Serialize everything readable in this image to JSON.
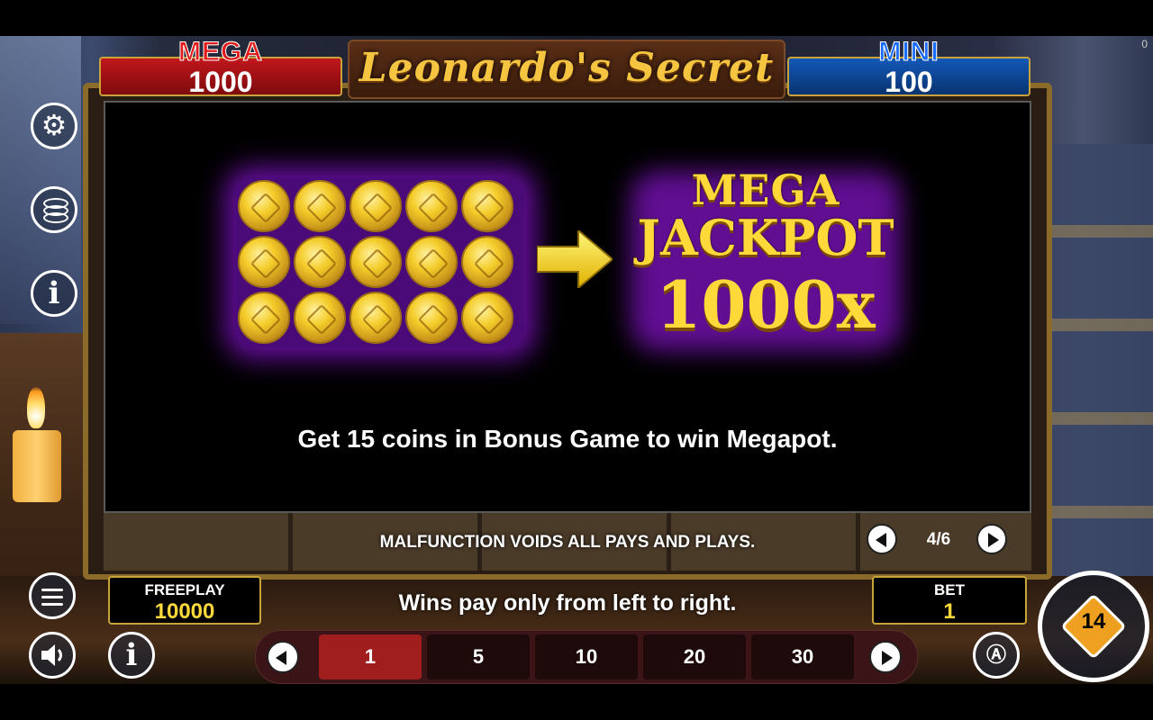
{
  "game": {
    "title": "Leonardo's Secret"
  },
  "jackpots": {
    "mega": {
      "label": "MEGA",
      "value": "1000"
    },
    "mini": {
      "label": "MINI",
      "value": "100"
    }
  },
  "corner_indicator": "0",
  "info_page": {
    "mega_title_line1": "MEGA",
    "mega_title_line2": "JACKPOT",
    "multiplier": "1000x",
    "coin_count": 15,
    "description": "Get 15 coins in Bonus Game to win Megapot.",
    "disclaimer": "MALFUNCTION VOIDS ALL PAYS AND PLAYS.",
    "page_indicator": "4/6"
  },
  "freeplay": {
    "label": "FREEPLAY",
    "value": "10000"
  },
  "bet": {
    "label": "BET",
    "value": "1"
  },
  "wins_note": "Wins pay only from left to right.",
  "bet_options": [
    "1",
    "5",
    "10",
    "20",
    "30"
  ],
  "selected_bet": "1",
  "spin_button": {
    "label": "14"
  },
  "icons": {
    "settings": "gear-icon",
    "paytable": "coin-stack-icon",
    "info": "info-icon",
    "menu": "hamburger-menu-icon",
    "sound": "speaker-icon",
    "autoplay": "autoplay-icon"
  },
  "colors": {
    "mega_red": "#c0171c",
    "mini_blue": "#1358b8",
    "gold": "#ffd93a",
    "selected_bet": "#a01e1e",
    "glow_purple": "#7a12b8"
  }
}
